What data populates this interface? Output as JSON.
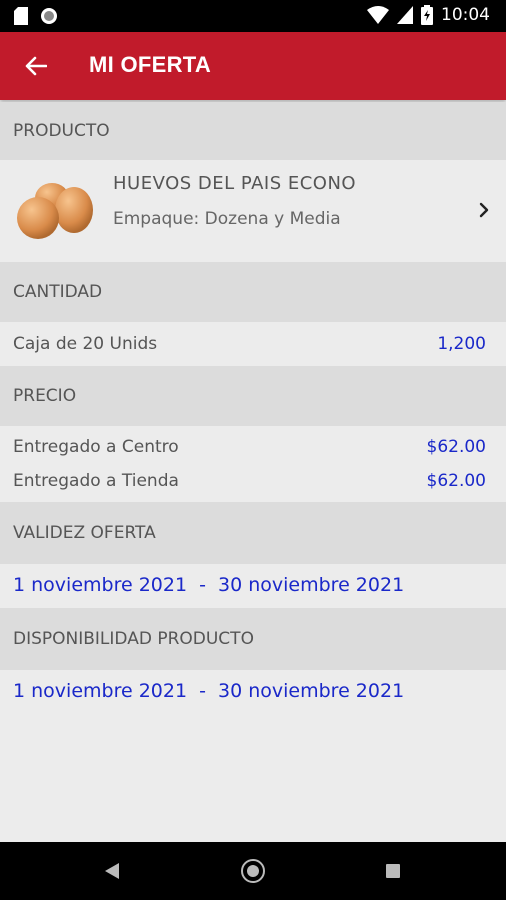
{
  "status_bar": {
    "time": "10:04"
  },
  "app_bar": {
    "title": "MI OFERTA"
  },
  "product": {
    "header": "PRODUCTO",
    "name": "HUEVOS DEL PAIS ECONO",
    "pack_label": "Empaque:",
    "pack_value": "Dozena y Media"
  },
  "quantity": {
    "header": "CANTIDAD",
    "label": "Caja de 20 Unids",
    "value": "1,200"
  },
  "price": {
    "header": "PRECIO",
    "rows": [
      {
        "label": "Entregado a Centro",
        "value": "$62.00"
      },
      {
        "label": "Entregado a Tienda",
        "value": "$62.00"
      }
    ]
  },
  "validity": {
    "header": "VALIDEZ OFERTA",
    "start": "1 noviembre 2021",
    "separator": "-",
    "end": "30 noviembre 2021"
  },
  "availability": {
    "header": "DISPONIBILIDAD PRODUCTO",
    "start": "1 noviembre 2021",
    "separator": "-",
    "end": "30 noviembre 2021"
  },
  "colors": {
    "accent": "#c11b2b",
    "value_blue": "#1a28c9"
  },
  "icons": [
    "sim-card-icon",
    "circle-notification-icon",
    "wifi-icon",
    "signal-icon",
    "battery-icon",
    "back-arrow-icon",
    "chevron-right-icon",
    "nav-back-icon",
    "nav-home-icon",
    "nav-recent-icon"
  ]
}
